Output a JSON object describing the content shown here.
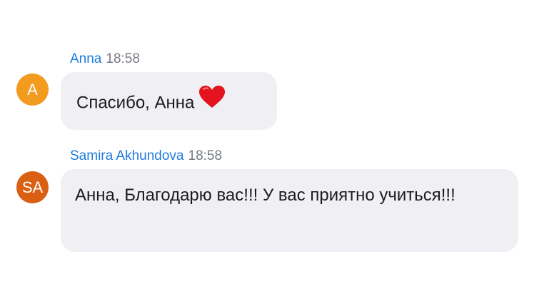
{
  "messages": [
    {
      "author": "Anna",
      "time": "18:58",
      "avatar_text": "A",
      "avatar_color": "#f29b1f",
      "text": "Спасибо, Анна",
      "emoji": "heart-icon"
    },
    {
      "author": "Samira Akhundova",
      "time": "18:58",
      "avatar_text": "SA",
      "avatar_color": "#d95f12",
      "text": "Анна, Благодарю вас!!! У вас приятно учиться!!!"
    }
  ],
  "colors": {
    "author_name": "#1f7ae0",
    "timestamp": "#777b85",
    "bubble_bg": "#f0f0f4",
    "heart": "#e3141d"
  }
}
